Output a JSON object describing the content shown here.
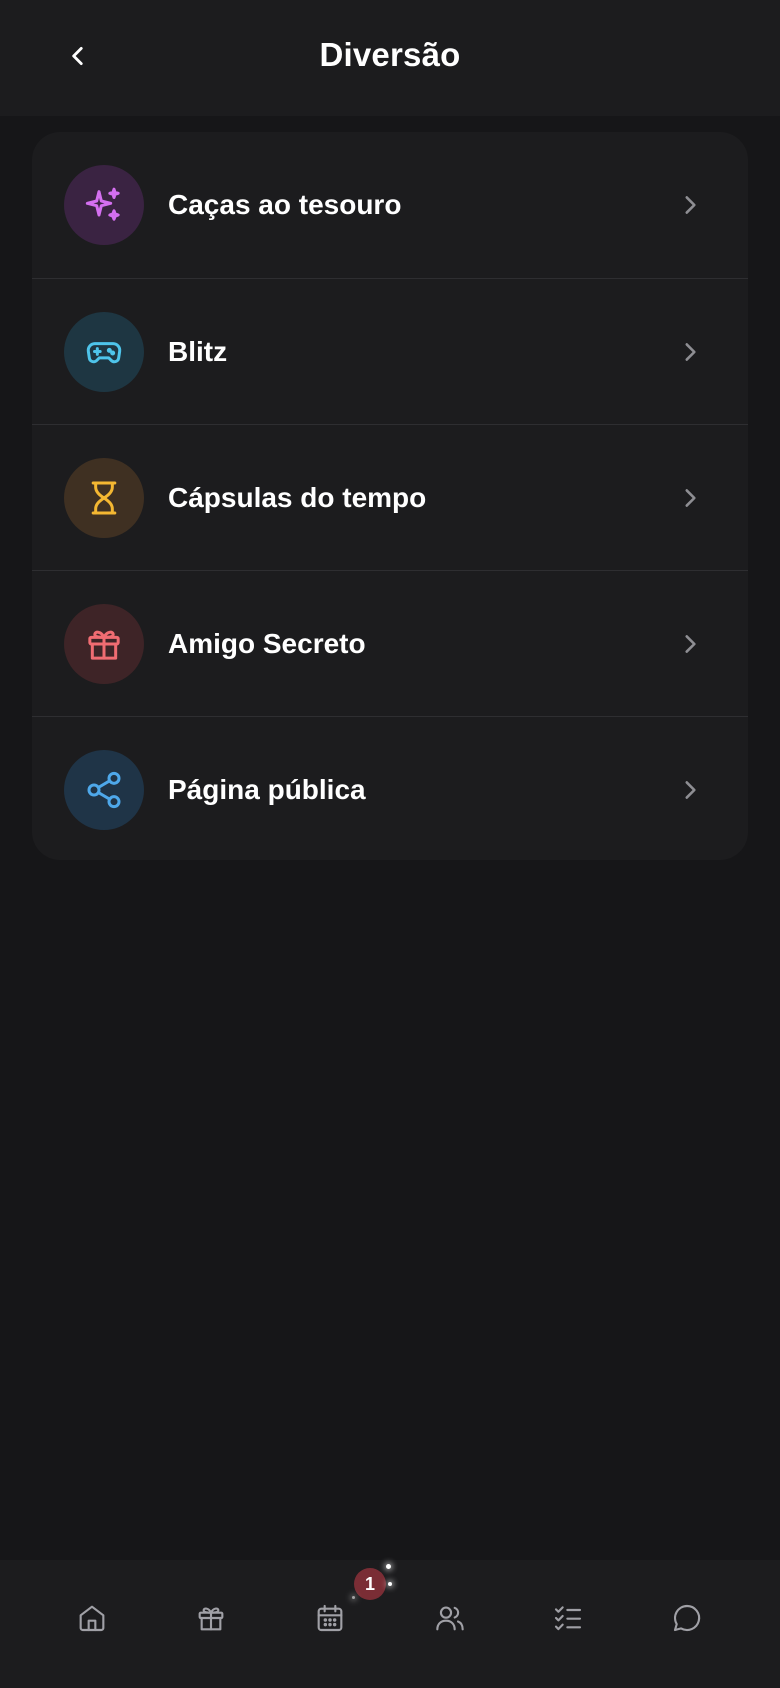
{
  "header": {
    "title": "Diversão",
    "back_icon": "chevron-left-icon"
  },
  "menu": {
    "items": [
      {
        "label": "Caças ao tesouro",
        "icon": "sparkles-icon",
        "icon_color": "#d46ff0",
        "badge_color": "#3a2342"
      },
      {
        "label": "Blitz",
        "icon": "gamepad-icon",
        "icon_color": "#4ec4ea",
        "badge_color": "#1e3642"
      },
      {
        "label": "Cápsulas do tempo",
        "icon": "hourglass-icon",
        "icon_color": "#f4b732",
        "badge_color": "#3f3022"
      },
      {
        "label": "Amigo Secreto",
        "icon": "gift-icon",
        "icon_color": "#f06c72",
        "badge_color": "#3e2427"
      },
      {
        "label": "Página pública",
        "icon": "share-icon",
        "icon_color": "#4ea8ea",
        "badge_color": "#1f3447"
      }
    ],
    "chevron_icon": "chevron-right-icon"
  },
  "bottom_nav": {
    "items": [
      {
        "icon": "home-icon"
      },
      {
        "icon": "gift-icon"
      },
      {
        "icon": "calendar-icon"
      },
      {
        "icon": "users-icon"
      },
      {
        "icon": "checklist-icon"
      },
      {
        "icon": "chat-icon"
      }
    ],
    "notification_count": "1",
    "badge_color": "#7a2d35"
  },
  "colors": {
    "background": "#161618",
    "surface": "#1c1c1e",
    "divider": "#2e2e31",
    "chevron": "#8e8e93",
    "nav_icon": "#a0a0a6"
  }
}
